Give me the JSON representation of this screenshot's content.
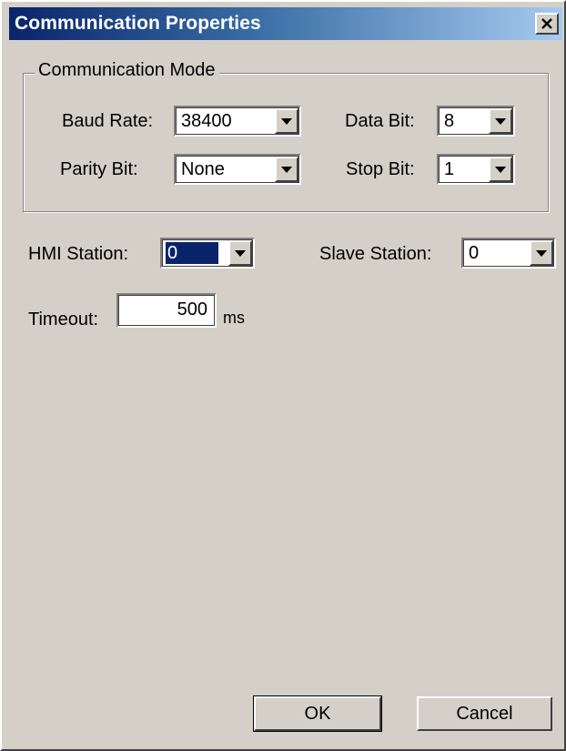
{
  "window": {
    "title": "Communication Properties",
    "close_icon": "close-icon"
  },
  "communication_mode": {
    "legend": "Communication Mode",
    "baud_rate": {
      "label": "Baud Rate:",
      "value": "38400"
    },
    "data_bit": {
      "label": "Data Bit:",
      "value": "8"
    },
    "parity_bit": {
      "label": "Parity Bit:",
      "value": "None"
    },
    "stop_bit": {
      "label": "Stop Bit:",
      "value": "1"
    }
  },
  "hmi_station": {
    "label": "HMI Station:",
    "value": "0"
  },
  "slave_station": {
    "label": "Slave Station:",
    "value": "0"
  },
  "timeout": {
    "label": "Timeout:",
    "value": "500",
    "unit": "ms"
  },
  "buttons": {
    "ok": "OK",
    "cancel": "Cancel"
  },
  "colors": {
    "dialog_face": "#d4d0c8",
    "title_gradient_start": "#0a246a",
    "title_gradient_end": "#a6caf0",
    "selection": "#0a246a"
  },
  "icons": {
    "dropdown": "chevron-down-icon",
    "close": "close-icon"
  }
}
